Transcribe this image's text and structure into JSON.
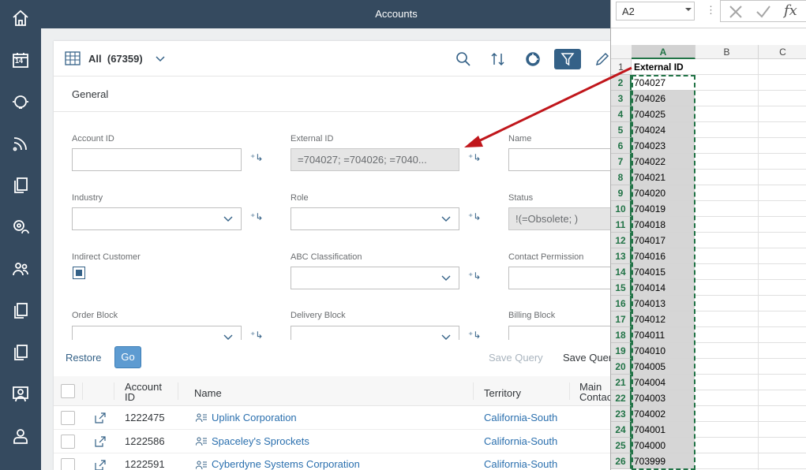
{
  "shell": {
    "title": "Accounts"
  },
  "sidebar": {
    "items": [
      {
        "icon": "home-icon"
      },
      {
        "icon": "calendar-icon",
        "text": "14"
      },
      {
        "icon": "support-icon"
      },
      {
        "icon": "feed-icon"
      },
      {
        "icon": "documents-icon"
      },
      {
        "icon": "settings-people-icon"
      },
      {
        "icon": "contacts-icon"
      },
      {
        "icon": "copy-icon"
      },
      {
        "icon": "copy-icon"
      },
      {
        "icon": "team-icon"
      },
      {
        "icon": "user-icon"
      }
    ]
  },
  "header": {
    "variant": "All",
    "count": "(67359)"
  },
  "filter": {
    "tab": "General",
    "fields": {
      "account_id": {
        "label": "Account ID",
        "value": ""
      },
      "external_id": {
        "label": "External ID",
        "value": "=704027; =704026; =7040..."
      },
      "name": {
        "label": "Name",
        "value": ""
      },
      "industry": {
        "label": "Industry",
        "value": ""
      },
      "role": {
        "label": "Role",
        "value": ""
      },
      "status": {
        "label": "Status",
        "value": "!(=Obsolete; )"
      },
      "indirect": {
        "label": "Indirect Customer"
      },
      "abc": {
        "label": "ABC Classification",
        "value": ""
      },
      "contact_perm": {
        "label": "Contact Permission",
        "value": ""
      },
      "order_block": {
        "label": "Order Block"
      },
      "delivery_block": {
        "label": "Delivery Block"
      },
      "billing_block": {
        "label": "Billing Block"
      }
    },
    "footer": {
      "restore": "Restore",
      "go": "Go",
      "save_query": "Save Query",
      "save_query_as": "Save Quer"
    }
  },
  "table": {
    "columns": {
      "account_id_l1": "Account",
      "account_id_l2": "ID",
      "name": "Name",
      "territory": "Territory",
      "main_contact_l1": "Main",
      "main_contact_l2": "Contac"
    },
    "rows": [
      {
        "id": "1222475",
        "name": "Uplink Corporation",
        "territory": "California-South"
      },
      {
        "id": "1222586",
        "name": "Spaceley's Sprockets",
        "territory": "California-South"
      },
      {
        "id": "1222591",
        "name": "Cyberdyne Systems Corporation",
        "territory": "California-South"
      }
    ]
  },
  "excel": {
    "name_box": "A2",
    "fx": "fx",
    "columns": [
      "A",
      "B",
      "C"
    ],
    "header_row": {
      "num": "1",
      "value": "External ID"
    },
    "rows": [
      {
        "num": "2",
        "value": "704027"
      },
      {
        "num": "3",
        "value": "704026"
      },
      {
        "num": "4",
        "value": "704025"
      },
      {
        "num": "5",
        "value": "704024"
      },
      {
        "num": "6",
        "value": "704023"
      },
      {
        "num": "7",
        "value": "704022"
      },
      {
        "num": "8",
        "value": "704021"
      },
      {
        "num": "9",
        "value": "704020"
      },
      {
        "num": "10",
        "value": "704019"
      },
      {
        "num": "11",
        "value": "704018"
      },
      {
        "num": "12",
        "value": "704017"
      },
      {
        "num": "13",
        "value": "704016"
      },
      {
        "num": "14",
        "value": "704015"
      },
      {
        "num": "15",
        "value": "704014"
      },
      {
        "num": "16",
        "value": "704013"
      },
      {
        "num": "17",
        "value": "704012"
      },
      {
        "num": "18",
        "value": "704011"
      },
      {
        "num": "19",
        "value": "704010"
      },
      {
        "num": "20",
        "value": "704005"
      },
      {
        "num": "21",
        "value": "704004"
      },
      {
        "num": "22",
        "value": "704003"
      },
      {
        "num": "23",
        "value": "704002"
      },
      {
        "num": "24",
        "value": "704001"
      },
      {
        "num": "25",
        "value": "704000"
      },
      {
        "num": "26",
        "value": "703999"
      }
    ]
  },
  "colors": {
    "shell": "#354a5f",
    "accent": "#346187",
    "link": "#2a6fae",
    "excel_green": "#217346",
    "arrow": "#c0161b"
  }
}
